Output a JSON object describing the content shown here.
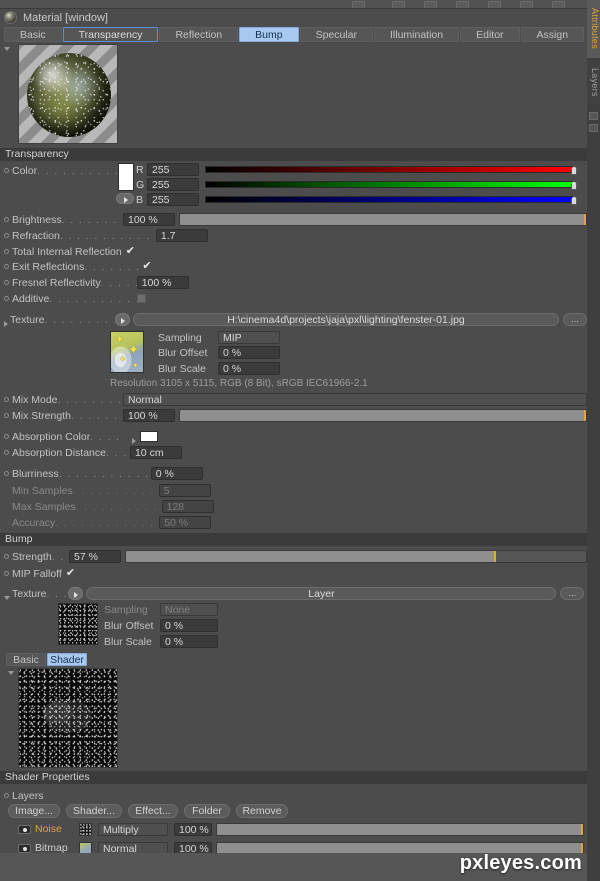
{
  "window": {
    "title": "Material [window]",
    "material_icon": "material-sphere-icon"
  },
  "dock": {
    "tabs": [
      {
        "label": "Attributes",
        "active": true
      },
      {
        "label": "Layers",
        "active": false
      }
    ]
  },
  "tabs": [
    {
      "label": "Basic",
      "state": "normal"
    },
    {
      "label": "Transparency",
      "state": "outlined"
    },
    {
      "label": "Reflection",
      "state": "normal"
    },
    {
      "label": "Bump",
      "state": "active"
    },
    {
      "label": "Specular",
      "state": "normal"
    },
    {
      "label": "Illumination",
      "state": "normal"
    },
    {
      "label": "Editor",
      "state": "normal"
    },
    {
      "label": "Assign",
      "state": "normal"
    }
  ],
  "transparency": {
    "header": "Transparency",
    "color": {
      "label": "Color",
      "dots": ". . . . . . . . . . . . . .",
      "channels": [
        {
          "name": "R",
          "value": "255"
        },
        {
          "name": "G",
          "value": "255"
        },
        {
          "name": "B",
          "value": "255"
        }
      ],
      "swatch_hex": "#ffffff"
    },
    "brightness": {
      "label": "Brightness",
      "dots": ". . . . . . . . . . .",
      "value": "100 %",
      "slider_pct": 100
    },
    "refraction": {
      "label": "Refraction",
      "dots": ". . . . . . . . . . . .",
      "value": "1.7"
    },
    "total_internal_reflection": {
      "label": "Total Internal Reflection",
      "checked": true,
      "check_glyph": "✔"
    },
    "exit_reflections": {
      "label": "Exit Reflections",
      "dots": ". . . . . . . .",
      "checked": true,
      "check_glyph": "✔"
    },
    "fresnel_reflectivity": {
      "label": "Fresnel Reflectivity",
      "dots": ". . . . .",
      "value": "100 %"
    },
    "additive": {
      "label": "Additive",
      "dots": ". . . . . . . . . . . . .",
      "checked": false
    },
    "texture": {
      "label": "Texture",
      "dots": ". . . . . . . . . . . . .",
      "path": "H:\\cinema4d\\projects\\jaja\\pxl\\lighting\\fenster-01.jpg",
      "browse_label": "...",
      "sampling": {
        "label": "Sampling",
        "value": "MIP"
      },
      "blur_offset": {
        "label": "Blur Offset",
        "value": "0 %"
      },
      "blur_scale": {
        "label": "Blur Scale",
        "value": "0 %"
      },
      "resolution_info": "Resolution 3105 x 5115, RGB (8 Bit), sRGB IEC61966-2.1"
    },
    "mix_mode": {
      "label": "Mix Mode",
      "dots": ". . . . . . . . . . . .",
      "value": "Normal"
    },
    "mix_strength": {
      "label": "Mix Strength",
      "dots": ". . . . . . . . .",
      "value": "100 %",
      "slider_pct": 100
    },
    "absorption_color": {
      "label": "Absorption Color",
      "dots": ". . . .",
      "swatch_hex": "#ffffff"
    },
    "absorption_distance": {
      "label": "Absorption Distance",
      "dots": ". . .",
      "value": "10 cm"
    },
    "blurriness": {
      "label": "Blurriness",
      "dots": ". . . . . . . . . . . .",
      "value": "0 %"
    },
    "min_samples": {
      "label": "Min Samples",
      "dots": ". . . . . . . . . .",
      "value": "5",
      "disabled": true
    },
    "max_samples": {
      "label": "Max Samples",
      "dots": ". . . . . . . . . .",
      "value": "128",
      "disabled": true
    },
    "accuracy": {
      "label": "Accuracy",
      "dots": ". . . . . . . . . . . . .",
      "value": "50 %",
      "disabled": true
    }
  },
  "bump": {
    "header": "Bump",
    "strength": {
      "label": "Strength",
      "dots": ". . . . . . . . . . . . .",
      "value": "57 %",
      "slider_pct": 80
    },
    "mip_falloff": {
      "label": "MIP Falloff",
      "checked": true,
      "check_glyph": "✔"
    },
    "texture": {
      "label": "Texture",
      "dots": ". . .",
      "value": "Layer",
      "browse_label": "...",
      "sampling": {
        "label": "Sampling",
        "value": "None",
        "disabled": true
      },
      "blur_offset": {
        "label": "Blur Offset",
        "value": "0 %"
      },
      "blur_scale": {
        "label": "Blur Scale",
        "value": "0 %"
      }
    },
    "shader_tabs": [
      {
        "label": "Basic",
        "active": false
      },
      {
        "label": "Shader",
        "active": true
      }
    ]
  },
  "shader_properties": {
    "header": "Shader Properties",
    "layers_label": "Layers",
    "buttons": [
      {
        "label": "Image...",
        "name": "image-button"
      },
      {
        "label": "Shader...",
        "name": "shader-button"
      },
      {
        "label": "Effect...",
        "name": "effect-button"
      },
      {
        "label": "Folder",
        "name": "folder-button"
      },
      {
        "label": "Remove",
        "name": "remove-button"
      }
    ],
    "layers": [
      {
        "name": "Noise",
        "blend": "Multiply",
        "opacity": "100 %",
        "color": "#e0a33c",
        "visible": true
      },
      {
        "name": "Bitmap",
        "blend": "Normal",
        "opacity": "100 %",
        "color": "#cfcfcf",
        "visible": true
      }
    ]
  },
  "watermark": "pxleyes.com",
  "accent": {
    "tab_active_bg": "#a8c8ef",
    "tab_outline": "#5c8fd6",
    "slider_knob": "#e0a73c",
    "noise_label": "#e0a33c"
  }
}
